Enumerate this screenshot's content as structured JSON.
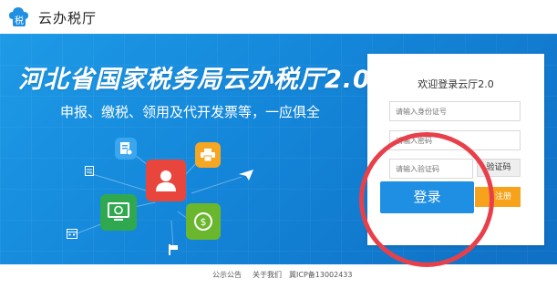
{
  "header": {
    "logo_char": "税",
    "app_name": "云办税厅"
  },
  "banner": {
    "title": "河北省国家税务局云办税厅2.0",
    "subtitle": "申报、缴税、领用及代开发票等，一应俱全"
  },
  "login": {
    "title": "欢迎登录云厅2.0",
    "id_placeholder": "请输入身份证号",
    "password_placeholder": "请输入密码",
    "captcha_placeholder": "请输入验证码",
    "captcha_label": "验证码",
    "login_label": "登录",
    "register_label": "注册"
  },
  "footer": {
    "announcement": "公示公告",
    "about": "关于我们",
    "icp": "冀ICP备13002433"
  },
  "colors": {
    "banner": "#1486d9",
    "login_button": "#1e8fe2",
    "register_button": "#f7a21b",
    "highlight_circle": "#e8404a"
  },
  "icons": [
    "tax-logo-icon",
    "document-icon",
    "printer-icon",
    "user-icon",
    "monitor-icon",
    "coin-icon",
    "calendar-icon",
    "list-icon",
    "paper-plane-icon",
    "flag-icon"
  ]
}
